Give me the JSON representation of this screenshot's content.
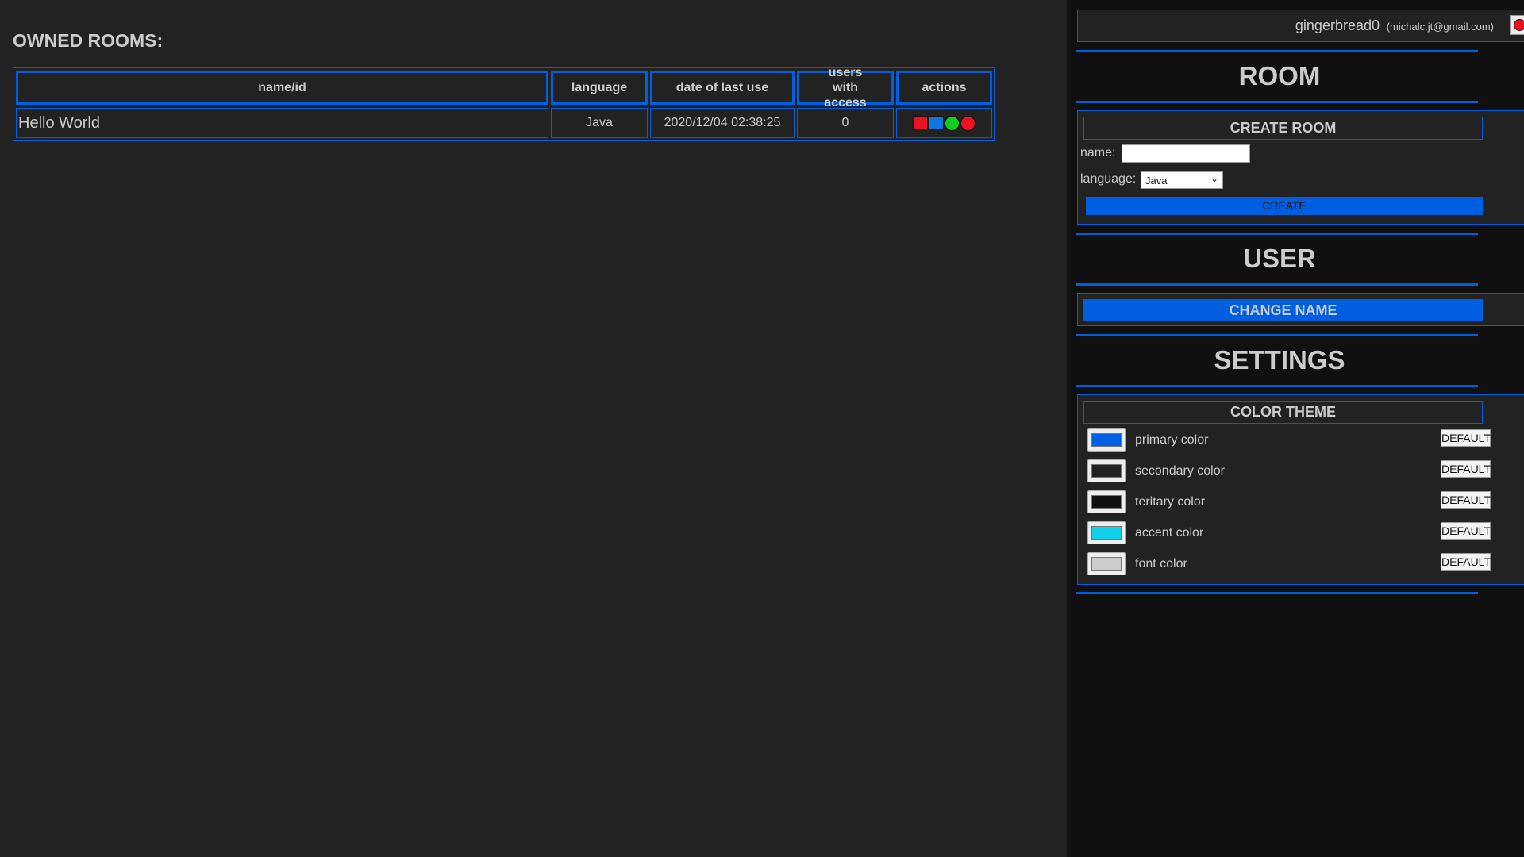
{
  "main": {
    "title": "OWNED ROOMS:",
    "columns": [
      "name/id",
      "language",
      "date of last use",
      "users with access",
      "actions"
    ],
    "rows": [
      {
        "name": "Hello World",
        "language": "Java",
        "date": "2020/12/04 02:38:25",
        "users": "0",
        "actions": [
          {
            "icon": "red-square-icon",
            "color": "#ee1122"
          },
          {
            "icon": "blue-square-icon",
            "color": "#1177dd"
          },
          {
            "icon": "green-circle-icon",
            "color": "#11cc22"
          },
          {
            "icon": "red-circle-icon",
            "color": "#ee1122"
          }
        ]
      }
    ]
  },
  "user": {
    "name": "gingerbread0",
    "email": "(michalc.jt@gmail.com)",
    "logout_icon": "red-circle-icon"
  },
  "room": {
    "heading": "ROOM",
    "create_title": "CREATE ROOM",
    "name_label": "name:",
    "name_value": "",
    "language_label": "language:",
    "language_value": "Java",
    "create_button": "CREATE"
  },
  "user_section": {
    "heading": "USER",
    "change_name_button": "CHANGE NAME"
  },
  "settings": {
    "heading": "SETTINGS",
    "theme_title": "COLOR THEME",
    "default_label": "DEFAULT",
    "colors": [
      {
        "label": "primary color",
        "value": "#005fe0"
      },
      {
        "label": "secondary color",
        "value": "#222222"
      },
      {
        "label": "teritary color",
        "value": "#101010"
      },
      {
        "label": "accent color",
        "value": "#12d0e8"
      },
      {
        "label": "font color",
        "value": "#cccccc"
      }
    ]
  }
}
